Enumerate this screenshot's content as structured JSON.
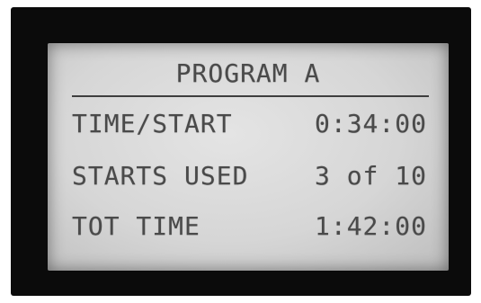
{
  "display": {
    "title": "PROGRAM A",
    "rows": [
      {
        "label": "TIME/START",
        "value": "0:34:00"
      },
      {
        "label": "STARTS USED",
        "value": "3 of 10"
      },
      {
        "label": "TOT TIME",
        "value": "1:42:00"
      }
    ]
  },
  "colors": {
    "bezel": "#0b0b0b",
    "lcd_background": "#d8d8d8",
    "lcd_text": "#4a4a4a"
  }
}
